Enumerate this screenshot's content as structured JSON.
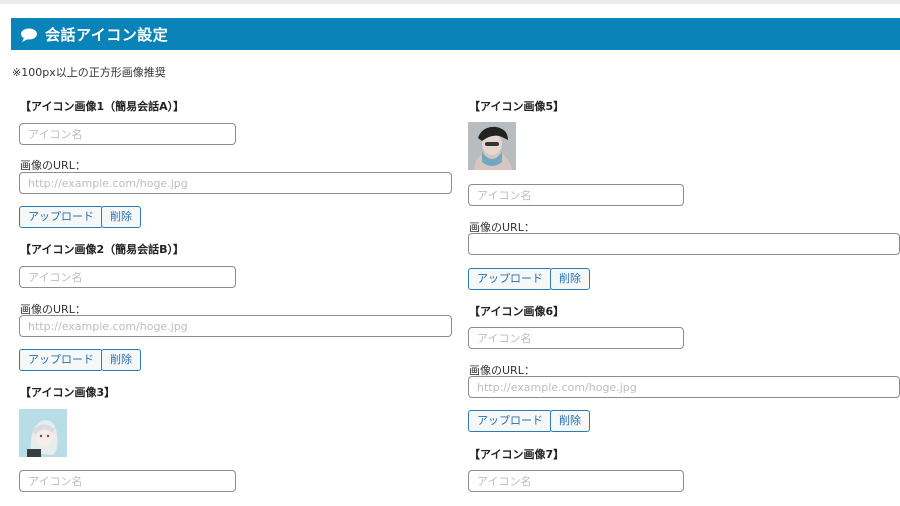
{
  "header": {
    "title": "会話アイコン設定",
    "icon": "speech-bubble-icon"
  },
  "note": "※100px以上の正方形画像推奨",
  "common": {
    "name_placeholder": "アイコン名",
    "url_label": "画像のURL：",
    "url_placeholder": "http://example.com/hoge.jpg",
    "upload": "アップロード",
    "delete": "削除"
  },
  "icons": [
    {
      "label": "【アイコン画像1（簡易会話A）】",
      "url_value": ""
    },
    {
      "label": "【アイコン画像2（簡易会話B）】",
      "url_value": ""
    },
    {
      "label": "【アイコン画像3】"
    },
    {
      "label": "【アイコン画像5】",
      "url_value": ""
    },
    {
      "label": "【アイコン画像6】",
      "url_value": ""
    },
    {
      "label": "【アイコン画像7】"
    }
  ]
}
